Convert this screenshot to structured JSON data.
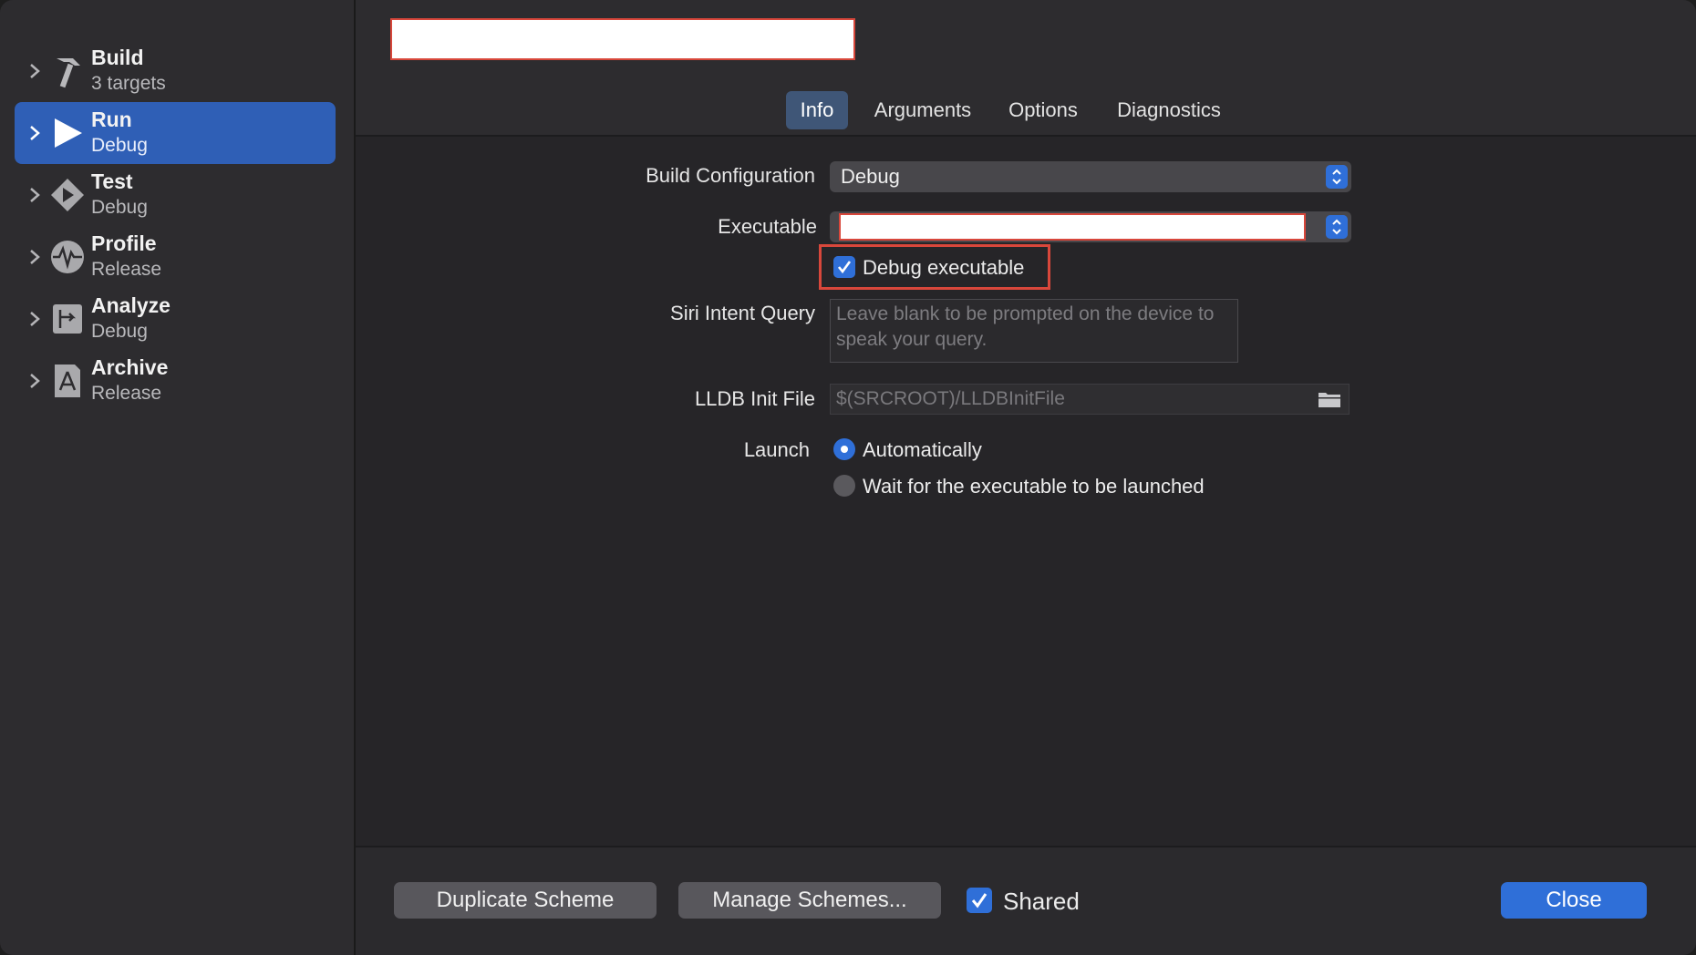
{
  "sidebar": {
    "items": [
      {
        "title": "Build",
        "subtitle": "3 targets",
        "icon": "hammer-icon"
      },
      {
        "title": "Run",
        "subtitle": "Debug",
        "icon": "play-icon"
      },
      {
        "title": "Test",
        "subtitle": "Debug",
        "icon": "test-diamond-icon"
      },
      {
        "title": "Profile",
        "subtitle": "Release",
        "icon": "profile-waveform-icon"
      },
      {
        "title": "Analyze",
        "subtitle": "Debug",
        "icon": "analyze-icon"
      },
      {
        "title": "Archive",
        "subtitle": "Release",
        "icon": "archive-icon"
      }
    ],
    "selected_index": 1
  },
  "header": {
    "scheme_name": "",
    "tabs": [
      "Info",
      "Arguments",
      "Options",
      "Diagnostics"
    ],
    "active_tab": "Info"
  },
  "form": {
    "build_configuration": {
      "label": "Build Configuration",
      "value": "Debug"
    },
    "executable": {
      "label": "Executable",
      "value": ""
    },
    "debug_executable": {
      "label": "Debug executable",
      "checked": true
    },
    "siri_intent_query": {
      "label": "Siri Intent Query",
      "placeholder": "Leave blank to be prompted on the device to speak your query."
    },
    "lldb_init_file": {
      "label": "LLDB Init File",
      "placeholder": "$(SRCROOT)/LLDBInitFile"
    },
    "launch": {
      "label": "Launch",
      "options": [
        "Automatically",
        "Wait for the executable to be launched"
      ],
      "selected": "Automatically"
    }
  },
  "footer": {
    "duplicate_label": "Duplicate Scheme",
    "manage_label": "Manage Schemes...",
    "shared_label": "Shared",
    "shared_checked": true,
    "close_label": "Close"
  },
  "colors": {
    "accent": "#2f6fd8",
    "highlight": "#d8473b",
    "sidebar_selected": "#2f5fb6"
  }
}
